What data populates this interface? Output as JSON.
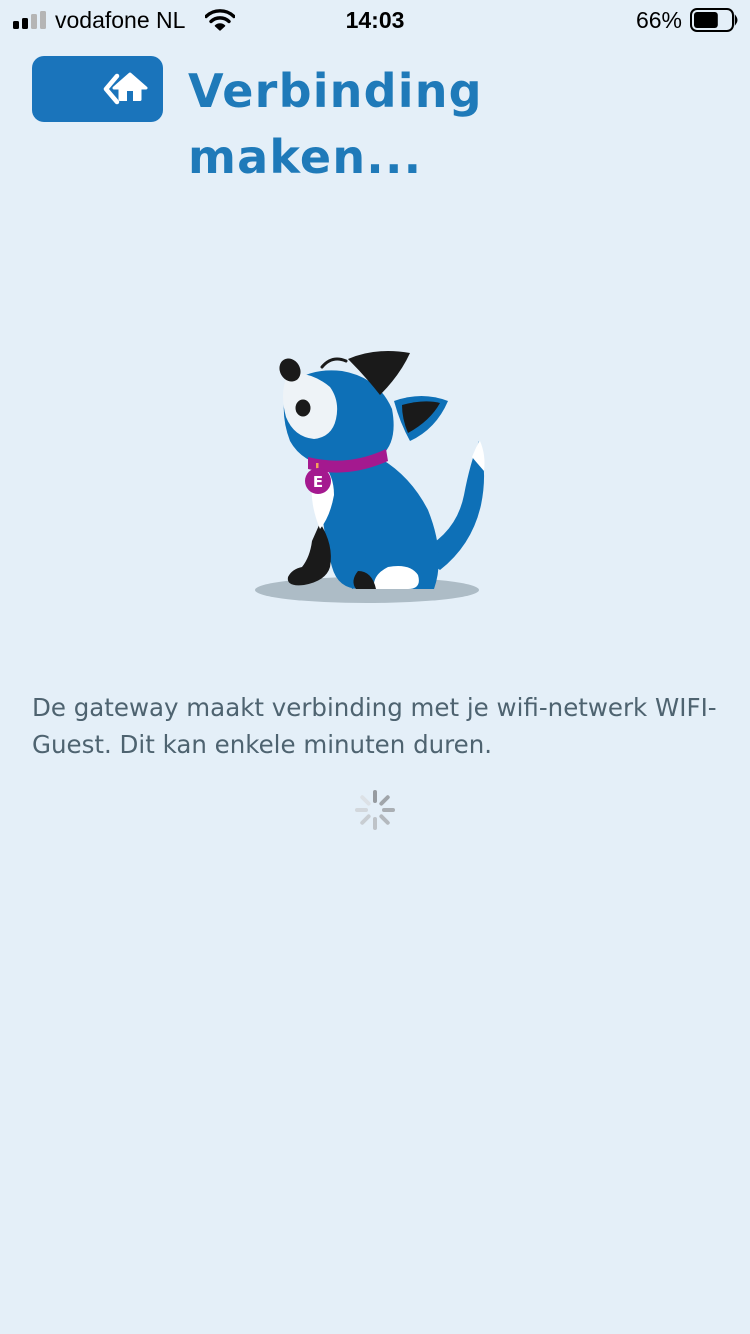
{
  "status_bar": {
    "carrier": "vodafone NL",
    "time": "14:03",
    "battery_percent": "66%",
    "battery_level": 0.66,
    "signal_bars_active": 2,
    "signal_bars_total": 4
  },
  "header": {
    "back_home_button_icons": [
      "chevron-left-icon",
      "home-icon"
    ],
    "title": "Verbinding maken..."
  },
  "main": {
    "illustration": "dog-mascot",
    "collar_tag_letter": "E",
    "message": "De gateway maakt verbinding met je wifi-netwerk WIFI-Guest. Dit kan enkele minuten duren.",
    "loading": true
  },
  "colors": {
    "background": "#e4eff8",
    "accent": "#1a74bb",
    "title": "#1f7ab9",
    "text": "#4e6370",
    "collar": "#a4198f"
  }
}
